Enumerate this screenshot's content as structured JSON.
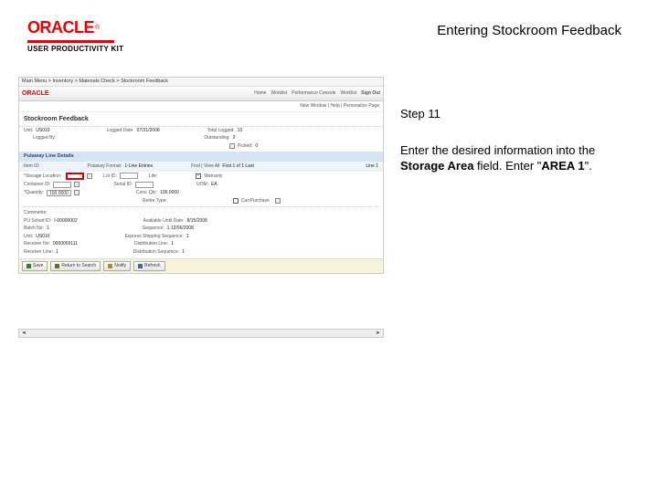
{
  "brand": {
    "name": "ORACLE",
    "product": "USER PRODUCTIVITY KIT"
  },
  "page_title": "Entering Stockroom Feedback",
  "step": {
    "label": "Step 11",
    "text_prefix": "Enter the desired information into the ",
    "field_name": "Storage Area",
    "text_mid": " field. Enter \"",
    "value": "AREA 1",
    "text_suffix": "\"."
  },
  "app": {
    "breadcrumb_left": "Main Menu > Inventory > Materials Check > Stockroom Feedback",
    "nav": {
      "home": "Home",
      "worklist": "Worklist",
      "perf": "Performance Console",
      "links": "Worklist",
      "signout": "Sign Out"
    },
    "subbar": "New Window | Help | Personalize Page",
    "screen_title": "Stockroom Feedback",
    "header_fields": {
      "unit_lbl": "Unit:",
      "unit": "US010",
      "logged_date_lbl": "Logged Date:",
      "logged_date": "07/31/2008",
      "total_logged_lbl": "Total Logged:",
      "total_logged": "10",
      "logged_by_lbl": "Logged By:",
      "outstanding_lbl": "Outstanding:",
      "outstanding": "2",
      "picked_lbl": "Picked:",
      "picked": "0"
    },
    "putaway_section": "Putaway Line Details",
    "grid_header": {
      "item_lbl": "Item ID:",
      "type_lbl": "Putaway Format:",
      "type_val": "1-Line Entries",
      "find_lbl": "Find | View All",
      "find_nav": "First 1 of 1 Last",
      "line_right": "Line 1"
    },
    "row1": {
      "storage_lbl": "*Storage Location:",
      "lot_lbl": "Lot ID:",
      "life_lbl": "Life:",
      "warranty_lbl": "Warranty"
    },
    "row2": {
      "container_lbl": "Container ID:",
      "serial_lbl": "Serial ID:",
      "uom_lbl": "UOM:",
      "uom_val": "EA"
    },
    "row3": {
      "qty_lbl": "*Quantity:",
      "qty_val": "100.0000",
      "conv_lbl": "Conv. Qty:",
      "conv_val": "100.0000"
    },
    "row4": {
      "retire_lbl": "Retire Type:",
      "owned_lbl": "CurrPurchase"
    },
    "row5": {
      "comments_lbl": "Comments:"
    },
    "row6": {
      "pu_lbl": "PU Sched ID:",
      "pu_val": "I-00000002",
      "avail_lbl": "Available Until Date:",
      "avail_val": "8/15/2008"
    },
    "row7": {
      "batch_lbl": "Batch No:",
      "batch_val": "1",
      "seq_lbl": "Sequence:",
      "seq_val": "1 12/06/2008"
    },
    "row8": {
      "unit_lbl": "Unit:",
      "unit_val": "US010",
      "shipseq_lbl": "Express Shipping Sequence:",
      "shipseq_val": "1"
    },
    "row9": {
      "recv_lbl": "Receiver No:",
      "recv_val": "0000000111",
      "dist_lbl": "Distribution Line:",
      "dist_val": "1"
    },
    "row10": {
      "recvln_lbl": "Receiver Line:",
      "recvln_val": "1",
      "distseq_lbl": "Distribution Sequence:",
      "distseq_val": "1"
    },
    "buttons": {
      "save": "Save",
      "prev": "Return to Search",
      "notify": "Notify",
      "refresh": "Refresh"
    }
  }
}
